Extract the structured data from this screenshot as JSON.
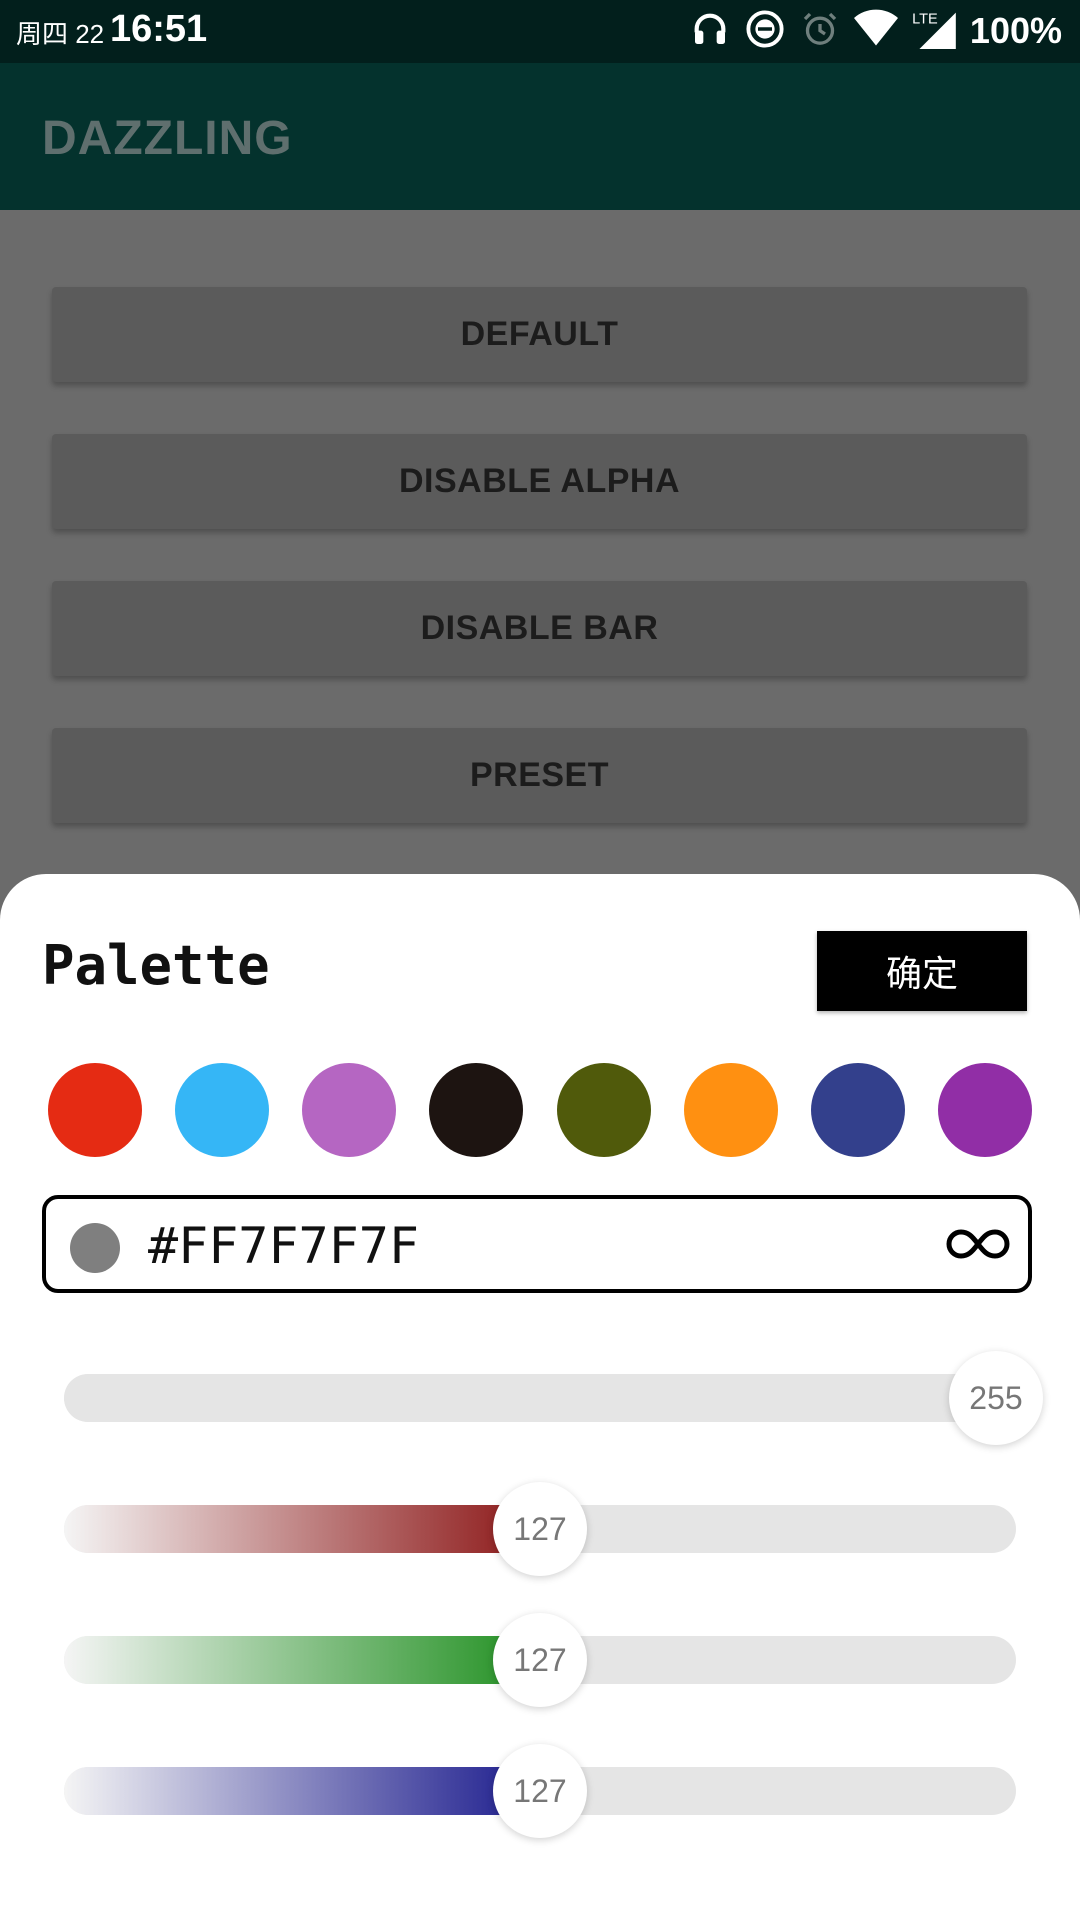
{
  "status_bar": {
    "date": "周四 22",
    "time": "16:51",
    "battery": "100%",
    "network": "LTE",
    "icons": [
      "headphones-icon",
      "do-not-disturb-icon",
      "alarm-icon",
      "wifi-icon",
      "signal-icon"
    ]
  },
  "app_bar": {
    "title": "DAZZLING"
  },
  "buttons": [
    {
      "label": "DEFAULT"
    },
    {
      "label": "DISABLE ALPHA"
    },
    {
      "label": "DISABLE BAR"
    },
    {
      "label": "PRESET"
    }
  ],
  "palette": {
    "title": "Palette",
    "confirm_label": "确定",
    "swatches": [
      "#e52b13",
      "#35b6f6",
      "#b566c2",
      "#1d1411",
      "#505a0b",
      "#ff9011",
      "#33408c",
      "#912ea6"
    ],
    "hex_value": "#FF7F7F7F",
    "preview_color": "#7f7f7f",
    "sliders": [
      {
        "channel": "alpha",
        "value": "255",
        "fraction": 1.0,
        "color": "#7f7f7f"
      },
      {
        "channel": "red",
        "value": "127",
        "fraction": 0.5,
        "color": "#8b1515"
      },
      {
        "channel": "green",
        "value": "127",
        "fraction": 0.5,
        "color": "#1f8f1f"
      },
      {
        "channel": "blue",
        "value": "127",
        "fraction": 0.5,
        "color": "#1a1a8c"
      }
    ]
  }
}
